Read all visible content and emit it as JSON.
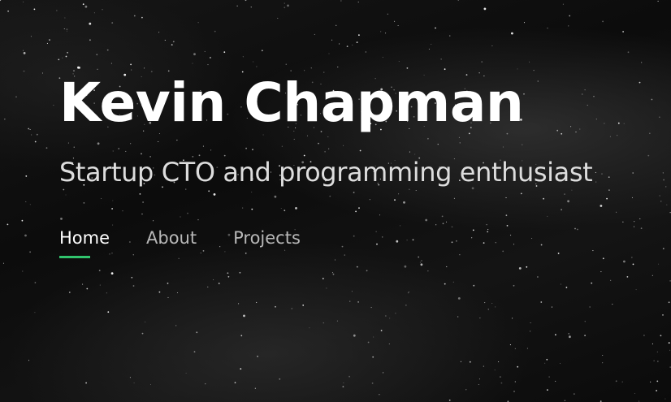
{
  "hero": {
    "title": "Kevin Chapman",
    "subtitle": "Startup CTO and programming enthusiast"
  },
  "nav": {
    "items": [
      {
        "label": "Home",
        "active": true
      },
      {
        "label": "About",
        "active": false
      },
      {
        "label": "Projects",
        "active": false
      }
    ]
  },
  "colors": {
    "accent": "#31c46d",
    "background": "#0c0c0c",
    "title": "#ffffff",
    "subtitle": "#dddddd",
    "nav_inactive": "#b8b8b8"
  }
}
